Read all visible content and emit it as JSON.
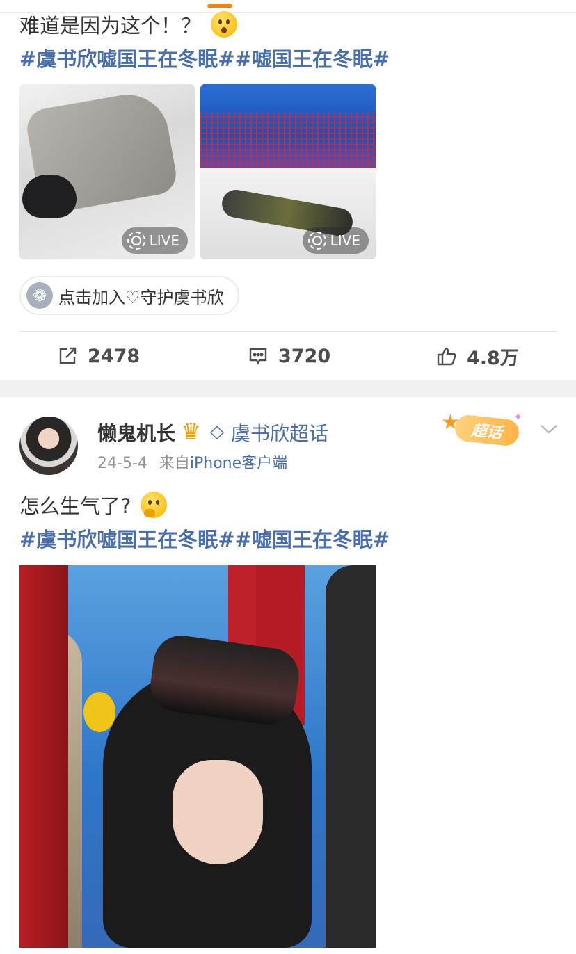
{
  "post1": {
    "text": "难道是因为这个！？",
    "emoji": "astonished-face",
    "hashtags": "#虞书欣嘘国王在冬眠##嘘国王在冬眠#",
    "images": [
      {
        "alt": "person in puffer jacket lying on snow",
        "live_label": "LIVE"
      },
      {
        "alt": "person lying on snow slope with turtle backpack",
        "live_label": "LIVE"
      }
    ],
    "supertopic_chip": "点击加入♡守护虞书欣",
    "actions": {
      "share_count": "2478",
      "comment_count": "3720",
      "like_count": "4.8万"
    }
  },
  "post2": {
    "username": "懒鬼机长",
    "topic_name": "虞书欣超话",
    "badge_label": "超话",
    "date": "24-5-4",
    "source_prefix": "来自",
    "source": "iPhone客户端",
    "text": "怎么生气了?",
    "emoji": "thinking-face",
    "hashtags": "#虞书欣嘘国王在冬眠##嘘国王在冬眠#"
  },
  "colors": {
    "accent": "#ff8200",
    "link": "#4a6ea8",
    "text": "#333333",
    "meta": "#939393"
  }
}
